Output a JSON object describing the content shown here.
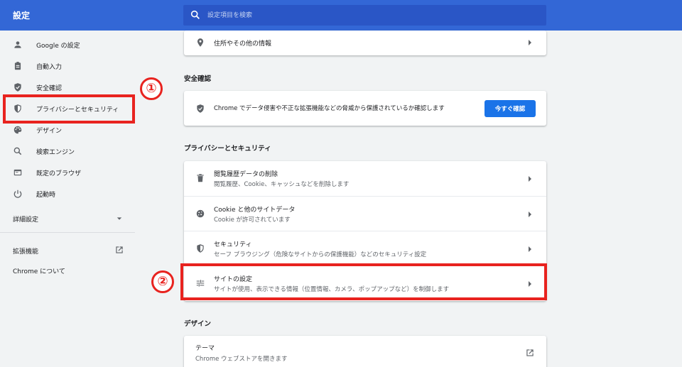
{
  "header": {
    "title": "設定",
    "search_placeholder": "設定項目を検索"
  },
  "sidebar": {
    "items": [
      {
        "label": "Google の設定",
        "icon": "person-icon"
      },
      {
        "label": "自動入力",
        "icon": "clipboard-icon"
      },
      {
        "label": "安全確認",
        "icon": "shield-check-icon"
      },
      {
        "label": "プライバシーとセキュリティ",
        "icon": "shield-icon"
      },
      {
        "label": "デザイン",
        "icon": "palette-icon"
      },
      {
        "label": "検索エンジン",
        "icon": "search-icon"
      },
      {
        "label": "既定のブラウザ",
        "icon": "browser-icon"
      },
      {
        "label": "起動時",
        "icon": "power-icon"
      }
    ],
    "advanced": "詳細設定",
    "extensions": "拡張機能",
    "about": "Chrome について"
  },
  "annotations": {
    "one": "①",
    "two": "②",
    "color": "#e8231f"
  },
  "main": {
    "autofill_row": {
      "title": "住所やその他の情報"
    },
    "safety": {
      "section_title": "安全確認",
      "text": "Chrome でデータ侵害や不正な拡張機能などの脅威から保護されているか確認します",
      "button": "今すぐ確認"
    },
    "privacy": {
      "section_title": "プライバシーとセキュリティ",
      "rows": [
        {
          "title": "閲覧履歴データの削除",
          "subtitle": "閲覧履歴、Cookie、キャッシュなどを削除します",
          "icon": "trash-icon"
        },
        {
          "title": "Cookie と他のサイトデータ",
          "subtitle": "Cookie が許可されています",
          "icon": "cookie-icon"
        },
        {
          "title": "セキュリティ",
          "subtitle": "セーフ ブラウジング（危険なサイトからの保護機能）などのセキュリティ設定",
          "icon": "shield-icon"
        },
        {
          "title": "サイトの設定",
          "subtitle": "サイトが使用、表示できる情報（位置情報、カメラ、ポップアップなど）を制御します",
          "icon": "tune-icon"
        }
      ]
    },
    "design": {
      "section_title": "デザイン",
      "theme_title": "テーマ",
      "theme_subtitle": "Chrome ウェブストアを開きます"
    }
  },
  "colors": {
    "header": "#3367d6",
    "search_bg": "#2a56c6",
    "primary_button": "#1a73e8",
    "background": "#f1f3f4"
  }
}
